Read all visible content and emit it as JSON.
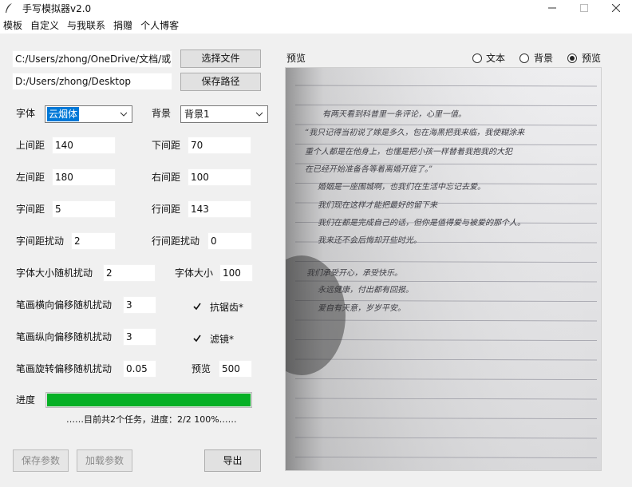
{
  "window": {
    "title": "手写模拟器v2.0",
    "minimize_icon": "minimize-icon",
    "maximize_icon": "maximize-icon",
    "close_icon": "close-icon"
  },
  "menu": [
    "模板",
    "自定义",
    "与我联系",
    "捐赠",
    "个人博客"
  ],
  "paths": {
    "source_file": "C:/Users/zhong/OneDrive/文档/或",
    "save_path": "D:/Users/zhong/Desktop",
    "select_file_label": "选择文件",
    "save_path_label": "保存路径"
  },
  "font": {
    "label": "字体",
    "value": "云烟体"
  },
  "background": {
    "label": "背景",
    "value": "背景1"
  },
  "params": {
    "top_margin": {
      "label": "上间距",
      "value": "140"
    },
    "bottom_margin": {
      "label": "下间距",
      "value": "70"
    },
    "left_margin": {
      "label": "左间距",
      "value": "180"
    },
    "right_margin": {
      "label": "右间距",
      "value": "100"
    },
    "char_spacing": {
      "label": "字间距",
      "value": "5"
    },
    "line_spacing": {
      "label": "行间距",
      "value": "143"
    },
    "char_spacing_jitter": {
      "label": "字间距扰动",
      "value": "2"
    },
    "line_spacing_jitter": {
      "label": "行间距扰动",
      "value": "0"
    },
    "font_size_jitter": {
      "label": "字体大小随机扰动",
      "value": "2"
    },
    "font_size": {
      "label": "字体大小",
      "value": "100"
    },
    "stroke_h_jitter": {
      "label": "笔画横向偏移随机扰动",
      "value": "3"
    },
    "stroke_v_jitter": {
      "label": "笔画纵向偏移随机扰动",
      "value": "3"
    },
    "stroke_rot_jitter": {
      "label": "笔画旋转偏移随机扰动",
      "value": "0.05"
    },
    "preview": {
      "label": "预览",
      "value": "500"
    }
  },
  "options": {
    "antialias": {
      "label": "抗锯齿*",
      "checked": true
    },
    "filter": {
      "label": "滤镜*",
      "checked": true
    }
  },
  "progress": {
    "label": "进度",
    "fraction": 1.0,
    "status": "……目前共2个任务，进度：2/2 100%……",
    "color": "#06b025"
  },
  "buttons": {
    "save_params": "保存参数",
    "load_params": "加载参数",
    "export": "导出"
  },
  "preview_panel": {
    "title": "预览",
    "modes": [
      {
        "label": "文本",
        "selected": false
      },
      {
        "label": "背景",
        "selected": false
      },
      {
        "label": "预览",
        "selected": true
      }
    ]
  },
  "handwriting_lines": [
    "有两天看到科普里一条评论，心里一值。",
    "“我只记得当初说了嫁是多久，包在海黑把我来临，我使糊涂来",
    "重个人都是在他身上，也懂是把小孩一样替着我抱我的大犯",
    "在已经开始准备各等着离婚开庭了。”",
    "婚姻是一座围城啊，也我们在生活中忘记去爱。",
    "我们现在这样才能把最好的留下来",
    "我们在都是完成自己的话，但你是值得爱与被爱的那个人。",
    "我来还不会后悔却开些时光。",
    "我们承受开心，承受快乐。",
    "永远健康，付出都有回报。",
    "爱自有天意，岁岁平安。"
  ]
}
